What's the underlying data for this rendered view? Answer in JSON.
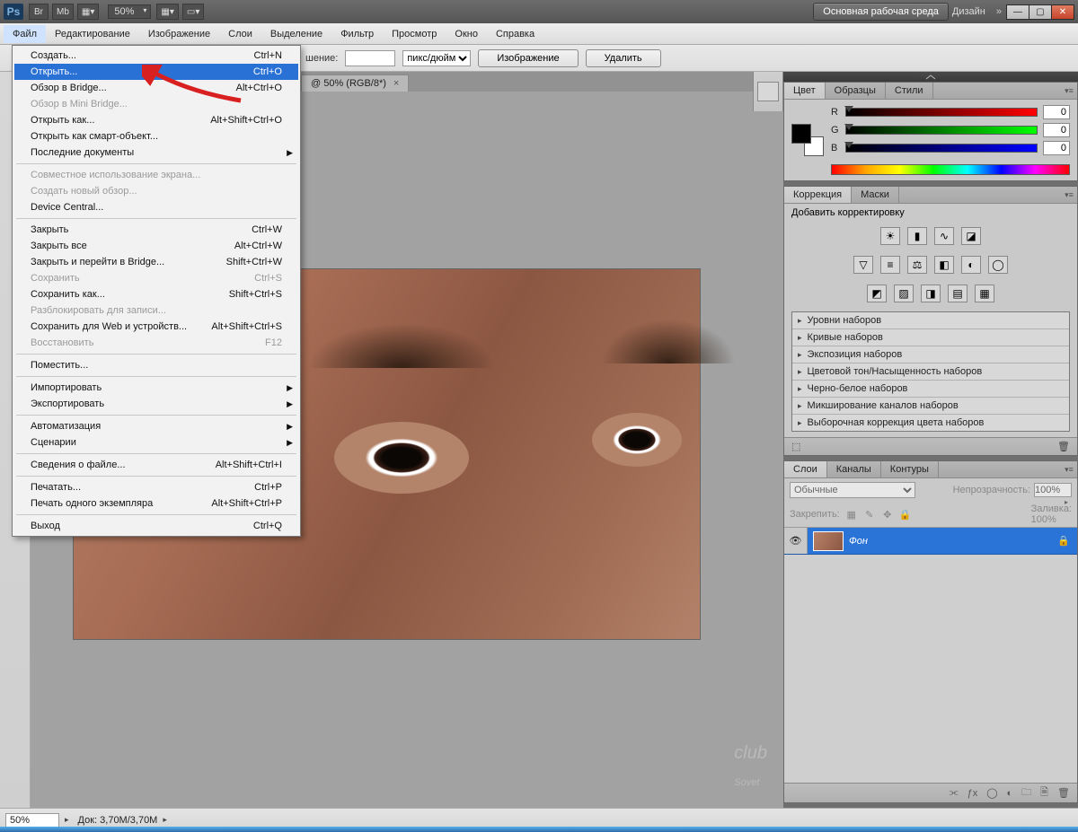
{
  "titlebar": {
    "logo": "Ps",
    "btn_br": "Br",
    "btn_mb": "Mb",
    "zoom": "50%",
    "workspace_primary": "Основная рабочая среда",
    "workspace_design": "Дизайн"
  },
  "menubar": {
    "items": [
      "Файл",
      "Редактирование",
      "Изображение",
      "Слои",
      "Выделение",
      "Фильтр",
      "Просмотр",
      "Окно",
      "Справка"
    ]
  },
  "optionsbar": {
    "label_suffix": "шение:",
    "value": "",
    "unit": "пикс/дюйм",
    "btn_image": "Изображение",
    "btn_delete": "Удалить"
  },
  "doctab": {
    "title": "@ 50% (RGB/8*)"
  },
  "fileMenu": [
    {
      "label": "Создать...",
      "shortcut": "Ctrl+N"
    },
    {
      "label": "Открыть...",
      "shortcut": "Ctrl+O",
      "hl": true
    },
    {
      "label": "Обзор в Bridge...",
      "shortcut": "Alt+Ctrl+O"
    },
    {
      "label": "Обзор в Mini Bridge...",
      "dis": true
    },
    {
      "label": "Открыть как...",
      "shortcut": "Alt+Shift+Ctrl+O"
    },
    {
      "label": "Открыть как смарт-объект..."
    },
    {
      "label": "Последние документы",
      "sub": true
    },
    {
      "sep": true
    },
    {
      "label": "Совместное использование экрана...",
      "dis": true
    },
    {
      "label": "Создать новый обзор...",
      "dis": true
    },
    {
      "label": "Device Central..."
    },
    {
      "sep": true
    },
    {
      "label": "Закрыть",
      "shortcut": "Ctrl+W"
    },
    {
      "label": "Закрыть все",
      "shortcut": "Alt+Ctrl+W"
    },
    {
      "label": "Закрыть и перейти в Bridge...",
      "shortcut": "Shift+Ctrl+W"
    },
    {
      "label": "Сохранить",
      "shortcut": "Ctrl+S",
      "dis": true
    },
    {
      "label": "Сохранить как...",
      "shortcut": "Shift+Ctrl+S"
    },
    {
      "label": "Разблокировать для записи...",
      "dis": true
    },
    {
      "label": "Сохранить для Web и устройств...",
      "shortcut": "Alt+Shift+Ctrl+S"
    },
    {
      "label": "Восстановить",
      "shortcut": "F12",
      "dis": true
    },
    {
      "sep": true
    },
    {
      "label": "Поместить..."
    },
    {
      "sep": true
    },
    {
      "label": "Импортировать",
      "sub": true
    },
    {
      "label": "Экспортировать",
      "sub": true
    },
    {
      "sep": true
    },
    {
      "label": "Автоматизация",
      "sub": true
    },
    {
      "label": "Сценарии",
      "sub": true
    },
    {
      "sep": true
    },
    {
      "label": "Сведения о файле...",
      "shortcut": "Alt+Shift+Ctrl+I"
    },
    {
      "sep": true
    },
    {
      "label": "Печатать...",
      "shortcut": "Ctrl+P"
    },
    {
      "label": "Печать одного экземпляра",
      "shortcut": "Alt+Shift+Ctrl+P"
    },
    {
      "sep": true
    },
    {
      "label": "Выход",
      "shortcut": "Ctrl+Q"
    }
  ],
  "panels": {
    "color": {
      "tabs": [
        "Цвет",
        "Образцы",
        "Стили"
      ],
      "r": "0",
      "g": "0",
      "b": "0"
    },
    "adjustments": {
      "tabs": [
        "Коррекция",
        "Маски"
      ],
      "header": "Добавить корректировку",
      "list": [
        "Уровни наборов",
        "Кривые наборов",
        "Экспозиция наборов",
        "Цветовой тон/Насыщенность наборов",
        "Черно-белое наборов",
        "Микширование каналов наборов",
        "Выборочная коррекция цвета наборов"
      ]
    },
    "layers": {
      "tabs": [
        "Слои",
        "Каналы",
        "Контуры"
      ],
      "blend": "Обычные",
      "opacity_label": "Непрозрачность:",
      "opacity": "100%",
      "lock_label": "Закрепить:",
      "fill_label": "Заливка:",
      "fill": "100%",
      "layer_name": "Фон"
    }
  },
  "statusbar": {
    "zoom": "50%",
    "doc": "Док: 3,70M/3,70M"
  },
  "watermark": {
    "small": "club",
    "big": "Sovet"
  }
}
